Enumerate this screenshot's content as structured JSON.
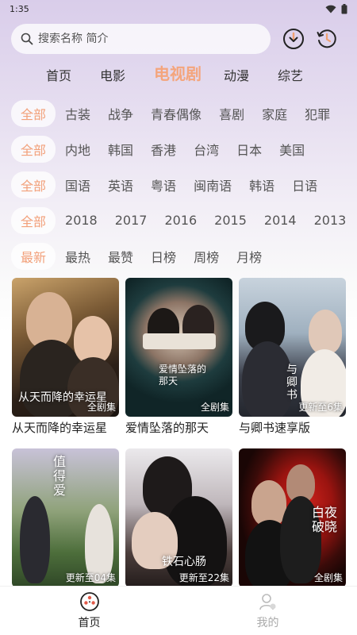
{
  "status": {
    "time": "1:35"
  },
  "search": {
    "placeholder": "搜索名称 简介"
  },
  "top_icons": [
    "download-icon",
    "history-icon"
  ],
  "main_tabs": [
    "首页",
    "电影",
    "电视剧",
    "动漫",
    "综艺"
  ],
  "active_main_tab": "电视剧",
  "filters": {
    "genre": [
      "全部",
      "古装",
      "战争",
      "青春偶像",
      "喜剧",
      "家庭",
      "犯罪"
    ],
    "region": [
      "全部",
      "内地",
      "韩国",
      "香港",
      "台湾",
      "日本",
      "美国"
    ],
    "language": [
      "全部",
      "国语",
      "英语",
      "粤语",
      "闽南语",
      "韩语",
      "日语"
    ],
    "year": [
      "全部",
      "2018",
      "2017",
      "2016",
      "2015",
      "2014",
      "2013"
    ],
    "sort": [
      "最新",
      "最热",
      "最赞",
      "日榜",
      "周榜",
      "月榜"
    ]
  },
  "items": [
    {
      "title": "从天而降的幸运星",
      "badge": "全剧集",
      "art": "从天而降的幸运星"
    },
    {
      "title": "爱情坠落的那天",
      "badge": "全剧集",
      "art": "爱情坠落的那天"
    },
    {
      "title": "与卿书速享版",
      "badge": "更新至6集",
      "art": "与卿书"
    },
    {
      "title": "",
      "badge": "更新至04集",
      "art": "值得爱"
    },
    {
      "title": "",
      "badge": "更新至22集",
      "art": "铁石心肠"
    },
    {
      "title": "",
      "badge": "全剧集",
      "art": "白夜破晓"
    }
  ],
  "bottom_nav": [
    {
      "label": "首页",
      "icon": "film-reel-icon",
      "active": true
    },
    {
      "label": "我的",
      "icon": "user-icon",
      "active": false
    }
  ],
  "colors": {
    "accent": "#f4a57d",
    "chip_active": "#f2a07a"
  }
}
